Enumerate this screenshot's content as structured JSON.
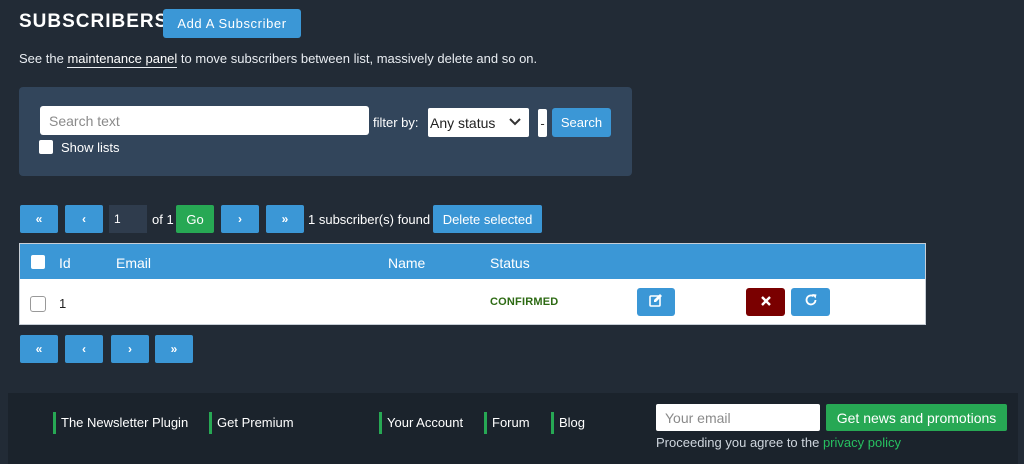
{
  "header": {
    "title": "SUBSCRIBERS",
    "add_button": "Add A Subscriber",
    "intro_prefix": "See the ",
    "intro_link": "maintenance panel",
    "intro_suffix": " to move subscribers between list, massively delete and so on."
  },
  "filter": {
    "search_placeholder": "Search text",
    "search_value": "",
    "filter_label": "filter by:",
    "status_selected": "Any status",
    "separator": "-",
    "search_button": "Search",
    "show_lists_label": "Show lists",
    "show_lists_checked": false
  },
  "pagination": {
    "first": "«",
    "prev": "‹",
    "next": "›",
    "last": "»",
    "current_page": "1",
    "of_text": "of 1",
    "go": "Go",
    "found_text": "1 subscriber(s) found",
    "delete_selected": "Delete selected"
  },
  "table": {
    "columns": [
      "Id",
      "Email",
      "Name",
      "Status"
    ],
    "rows": [
      {
        "id": "1",
        "email": "",
        "name": "",
        "status": "CONFIRMED"
      }
    ]
  },
  "footer": {
    "links": [
      "The Newsletter Plugin",
      "Get Premium",
      "Your Account",
      "Forum",
      "Blog"
    ],
    "email_placeholder": "Your email",
    "news_button": "Get news and promotions",
    "privacy_prefix": "Proceeding you agree to the ",
    "privacy_link": "privacy policy"
  },
  "colors": {
    "background": "#222b36",
    "panel": "#32455b",
    "accent_blue": "#3b97d6",
    "accent_green": "#27a854",
    "danger": "#7a0000",
    "status_confirmed": "#2d6a13"
  },
  "icons": [
    "chevron-down-icon",
    "edit-icon",
    "close-icon",
    "refresh-icon"
  ]
}
